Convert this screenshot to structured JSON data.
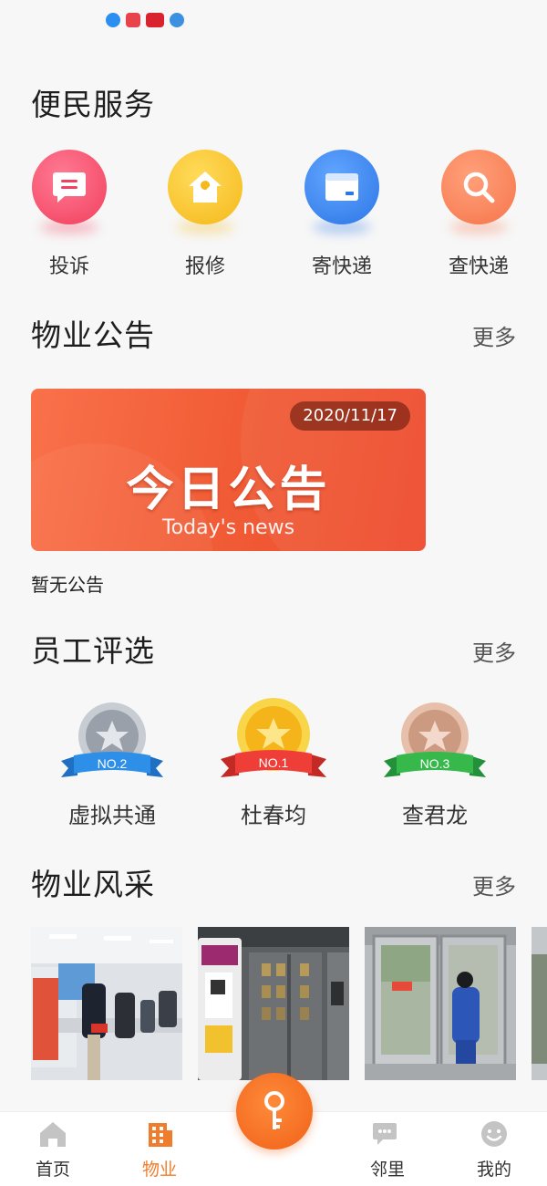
{
  "status_bar": {
    "icons": [
      "app-icon-1",
      "app-icon-2",
      "app-icon-3",
      "app-icon-4"
    ]
  },
  "services": {
    "title": "便民服务",
    "items": [
      {
        "label": "投诉",
        "icon": "message-icon",
        "color": "#f74a6a"
      },
      {
        "label": "报修",
        "icon": "house-wrench-icon",
        "color": "#f7c52a"
      },
      {
        "label": "寄快递",
        "icon": "package-icon",
        "color": "#3f8bf0"
      },
      {
        "label": "查快递",
        "icon": "search-icon",
        "color": "#f7835a"
      }
    ]
  },
  "announcements": {
    "title": "物业公告",
    "more": "更多",
    "banner": {
      "date": "2020/11/17",
      "headline": "今日公告",
      "subtitle": "Today's news"
    },
    "empty_text": "暂无公告"
  },
  "employee_rating": {
    "title": "员工评选",
    "more": "更多",
    "winners": [
      {
        "rank_label": "NO.2",
        "name": "虚拟共通",
        "medal": "silver",
        "ribbon_color": "#2d8fe8"
      },
      {
        "rank_label": "NO.1",
        "name": "杜春均",
        "medal": "gold",
        "ribbon_color": "#ef3d38"
      },
      {
        "rank_label": "NO.3",
        "name": "查君龙",
        "medal": "bronze",
        "ribbon_color": "#36b84a"
      }
    ]
  },
  "gallery": {
    "title": "物业风采",
    "more": "更多",
    "photos": [
      "photo-office-meeting",
      "photo-elevator-door",
      "photo-worker-at-door",
      "photo-partial"
    ]
  },
  "tab_bar": {
    "items": [
      {
        "label": "首页",
        "icon": "home-icon",
        "active": false
      },
      {
        "label": "物业",
        "icon": "building-icon",
        "active": true
      },
      {
        "label": "邻里",
        "icon": "chat-bubbles-icon",
        "active": false
      },
      {
        "label": "我的",
        "icon": "smiley-icon",
        "active": false
      }
    ],
    "center_icon": "key-icon",
    "accent": "#f07d2c"
  }
}
